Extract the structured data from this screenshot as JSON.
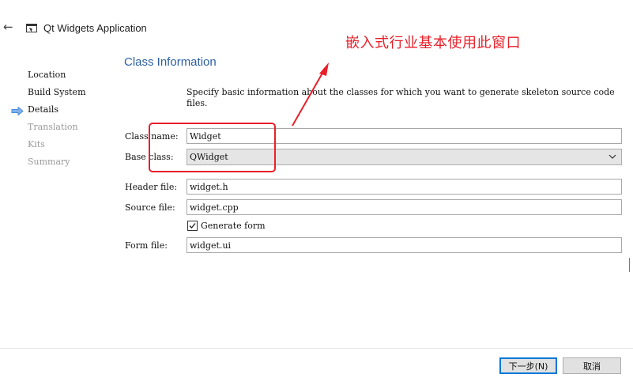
{
  "header": {
    "title": "Qt Widgets Application",
    "back_icon": "back-arrow-icon",
    "app_icon": "application-window-icon"
  },
  "sidebar": {
    "items": [
      {
        "label": "Location",
        "state": "done"
      },
      {
        "label": "Build System",
        "state": "done"
      },
      {
        "label": "Details",
        "state": "current"
      },
      {
        "label": "Translation",
        "state": "pending"
      },
      {
        "label": "Kits",
        "state": "pending"
      },
      {
        "label": "Summary",
        "state": "pending"
      }
    ],
    "current_indicator_color": "#4a8ad6"
  },
  "main": {
    "section_title": "Class Information",
    "description": "Specify basic information about the classes for which you want to generate skeleton source code files.",
    "fields": {
      "class_name": {
        "label": "Class name:",
        "value": "Widget"
      },
      "base_class": {
        "label": "Base class:",
        "value": "QWidget"
      },
      "header_file": {
        "label": "Header file:",
        "value": "widget.h"
      },
      "source_file": {
        "label": "Source file:",
        "value": "widget.cpp"
      },
      "generate_form": {
        "label": "Generate form",
        "checked": true
      },
      "form_file": {
        "label": "Form file:",
        "value": "widget.ui"
      }
    }
  },
  "annotation": {
    "text": "嵌入式行业基本使用此窗口",
    "color": "#e8202a"
  },
  "footer": {
    "next_label": "下一步(N)",
    "cancel_label": "取消"
  },
  "colors": {
    "section_title": "#2c5fa0",
    "disabled_text": "#9a9a9a",
    "default_button_border": "#0078d7"
  }
}
